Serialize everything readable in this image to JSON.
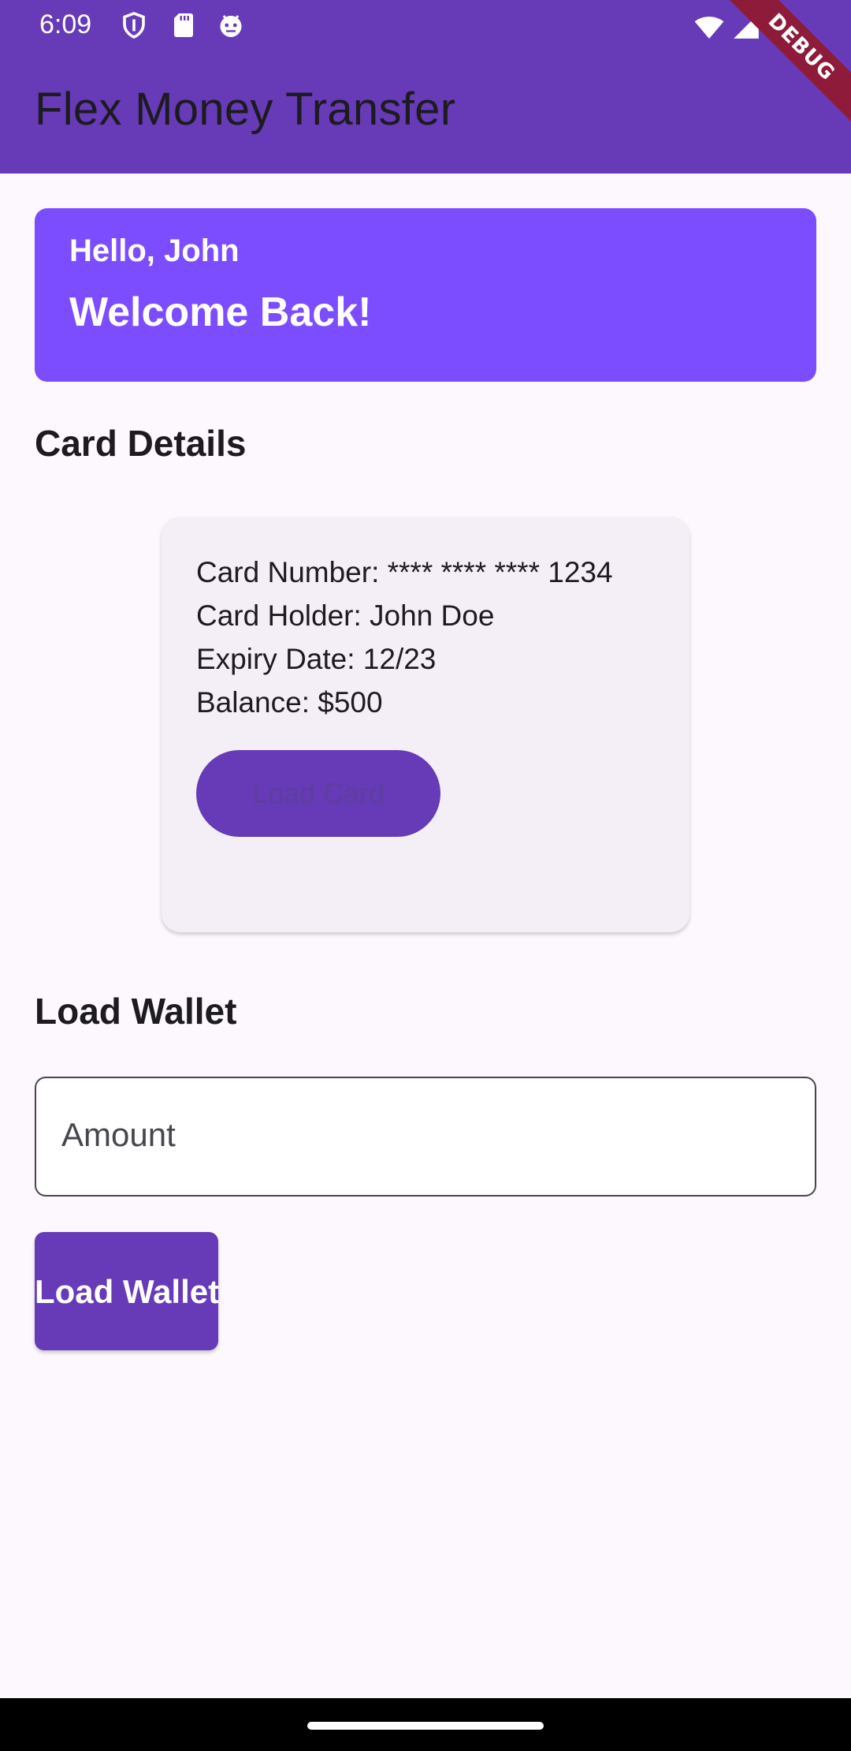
{
  "status_bar": {
    "time": "6:09"
  },
  "app_bar": {
    "title": "Flex Money Transfer",
    "debug_banner": "DEBUG"
  },
  "welcome": {
    "greeting": "Hello, John",
    "message": "Welcome Back!"
  },
  "card_section": {
    "title": "Card Details",
    "card_number": "Card Number: **** **** **** 1234",
    "card_holder": "Card Holder: John Doe",
    "expiry": "Expiry Date: 12/23",
    "balance": "Balance: $500",
    "load_card_label": "Load Card"
  },
  "wallet_section": {
    "title": "Load Wallet",
    "amount_label": "Amount",
    "load_wallet_label": "Load Wallet"
  },
  "colors": {
    "primary": "#673AB7",
    "welcome_bg": "#7C4DFF",
    "background": "#FDF7FE",
    "card_bg": "#F4EFF6",
    "debug_banner": "#8E1B3A"
  }
}
